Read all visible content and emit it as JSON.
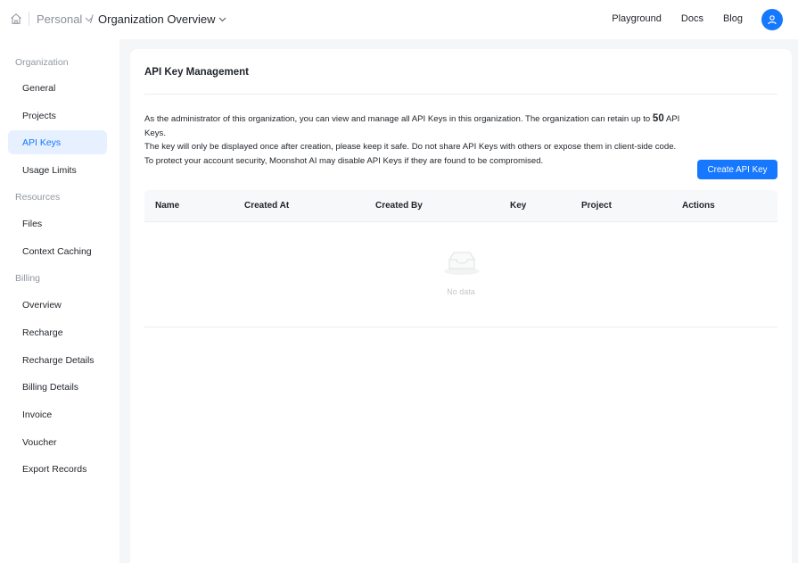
{
  "breadcrumb": {
    "personal": "Personal",
    "separator": "/",
    "organization": "Organization Overview"
  },
  "topnav": {
    "playground": "Playground",
    "docs": "Docs",
    "blog": "Blog"
  },
  "sidebar": {
    "sections": [
      {
        "title": "Organization",
        "items": [
          "General",
          "Projects",
          "API Keys",
          "Usage Limits"
        ]
      },
      {
        "title": "Resources",
        "items": [
          "Files",
          "Context Caching"
        ]
      },
      {
        "title": "Billing",
        "items": [
          "Overview",
          "Recharge",
          "Recharge Details",
          "Billing Details",
          "Invoice",
          "Voucher",
          "Export Records"
        ]
      }
    ],
    "active_item": "API Keys"
  },
  "main": {
    "title": "API Key Management",
    "description": {
      "line1_pre": "As the administrator of this organization, you can view and manage all API Keys in this organization. The organization can retain up to ",
      "limit": "50",
      "line1_post": " API Keys.",
      "line2": "The key will only be displayed once after creation, please keep it safe. Do not share API Keys with others or expose them in client-side code.",
      "line3": "To protect your account security, Moonshot AI may disable API Keys if they are found to be compromised."
    },
    "create_button": "Create API Key",
    "table": {
      "columns": [
        "Name",
        "Created At",
        "Created By",
        "Key",
        "Project",
        "Actions"
      ],
      "rows": [],
      "empty_text": "No data"
    }
  },
  "colors": {
    "accent": "#1677ff",
    "active_bg": "#e6f0ff",
    "page_bg": "#f5f6f7"
  }
}
